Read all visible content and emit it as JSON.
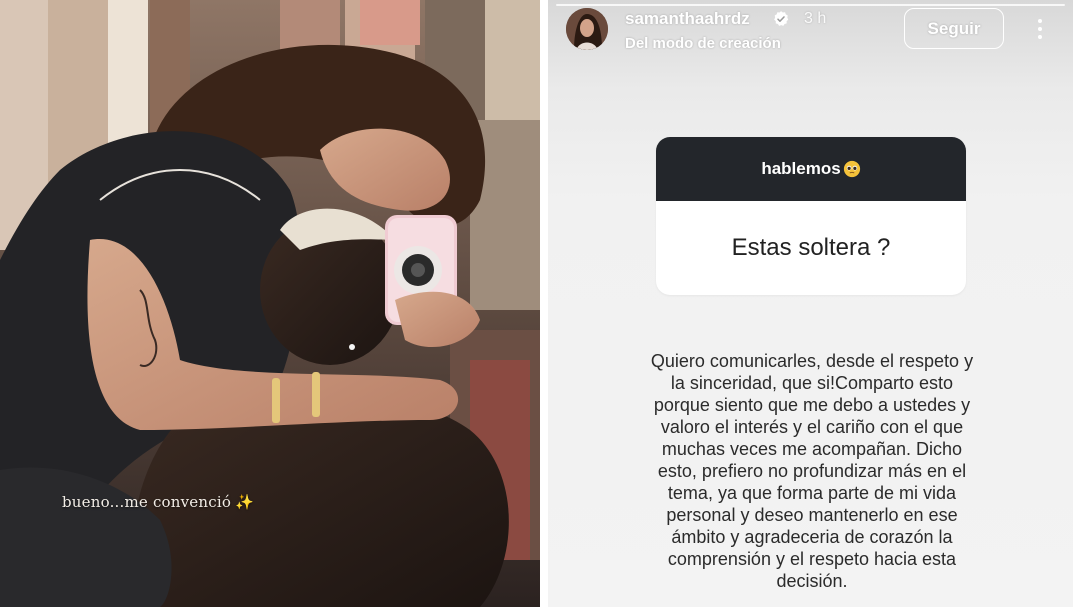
{
  "photo": {
    "caption": "bueno...me convenció",
    "caption_icon": "sparkle-icon"
  },
  "story": {
    "username": "samanthaahrdz",
    "time_ago": "3 h",
    "subtitle": "Del modo de creación",
    "follow_label": "Seguir",
    "question_header": "hablemos",
    "question_emoji": "pleading-face-icon",
    "question_text": "Estas soltera ?",
    "answer_text": "Quiero comunicarles, desde el respeto y\nla sinceridad, que si!Comparto esto\nporque siento que me debo a ustedes y\nvaloro el interés y el cariño con el que\nmuchas veces me acompañan. Dicho\nesto, prefiero no profundizar más en el\ntema, ya que forma parte de mi vida\npersonal y deseo mantenerlo en ese\námbito y agradeceria de corazón la\ncomprensión y el respeto hacia esta\ndecisión."
  },
  "colors": {
    "card_header": "#23262b",
    "verified": "#ffffff",
    "story_bg": "#f1f1f1"
  }
}
